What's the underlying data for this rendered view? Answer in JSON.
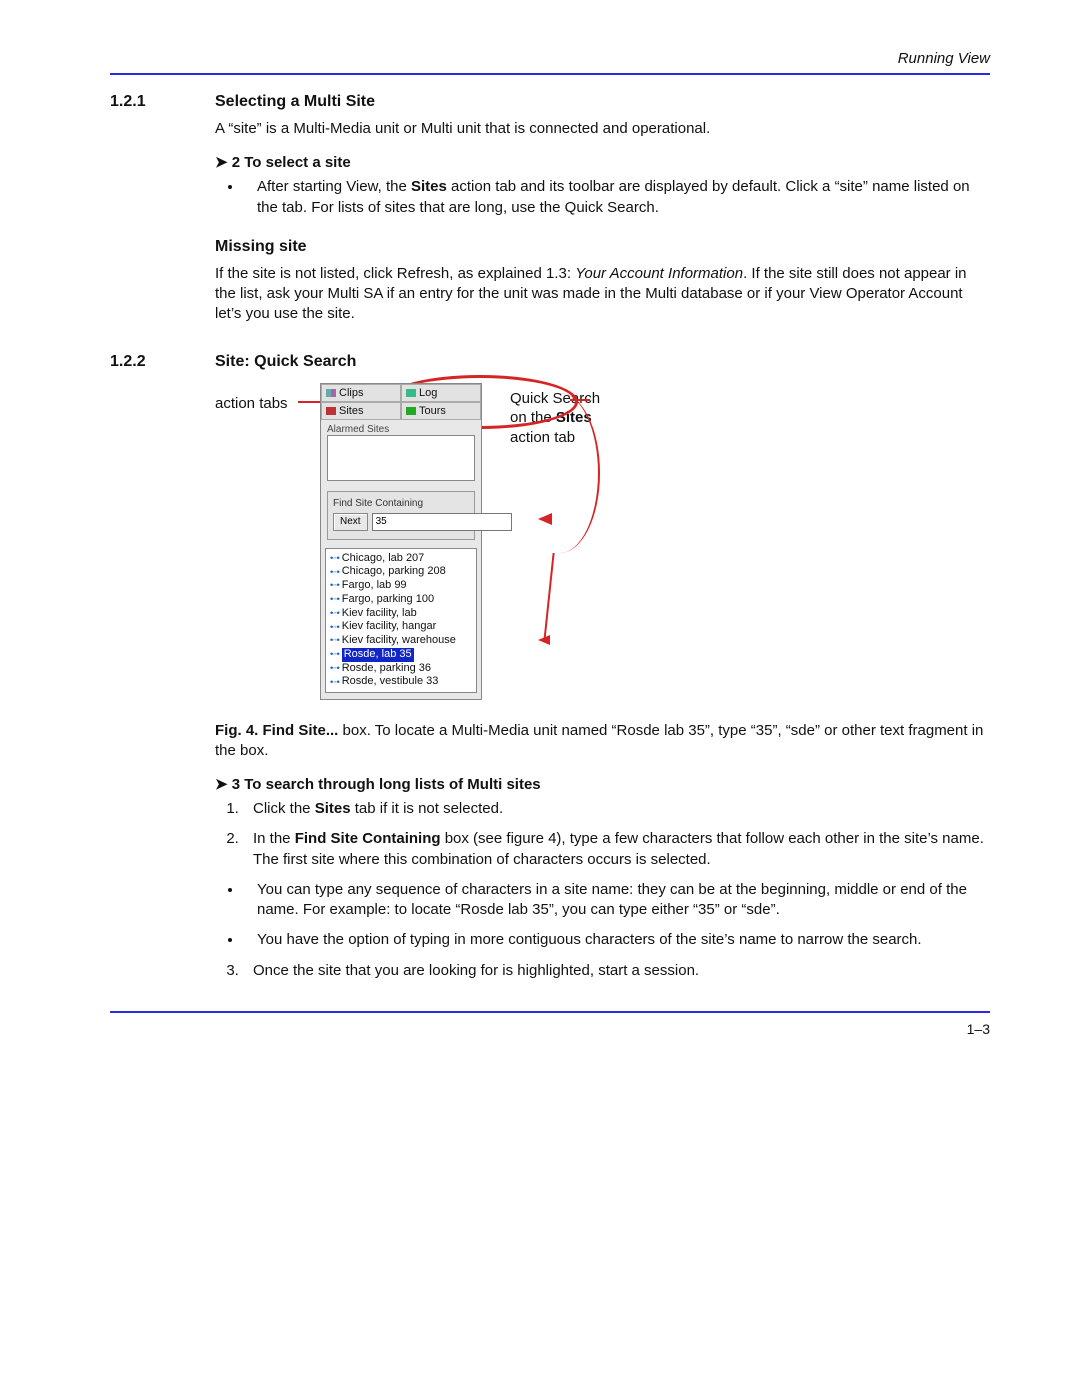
{
  "header": {
    "running": "Running View"
  },
  "sec121": {
    "num": "1.2.1",
    "title": "Selecting a Multi Site",
    "intro": "A “site” is a Multi-Media unit or Multi unit that is connected and operational.",
    "proc2_head": "➤ 2  To select a site",
    "bullet_pre": "After starting View, the ",
    "bullet_bold": "Sites",
    "bullet_post": " action tab and its toolbar are displayed by default. Click a “site” name listed on the tab. For lists of sites that are long, use the Quick Search.",
    "missing_head": "Missing site",
    "missing_pre": "If the site is not listed, click Refresh, as explained 1.3: ",
    "missing_ital": "Your Account Information",
    "missing_post": ". If the site still does not appear in the list, ask your Multi SA if an entry for the unit was made in the Multi database or if your View Operator Account let’s you use the site."
  },
  "sec122": {
    "num": "1.2.2",
    "title": "Site: Quick Search",
    "fig_left": "action tabs",
    "fig_right_l1": "Quick Search",
    "fig_right_l2_pre": "on the ",
    "fig_right_l2_bold": "Sites",
    "fig_right_l3": "action tab",
    "panel": {
      "tabs": {
        "clips": "Clips",
        "log": "Log",
        "sites": "Sites",
        "tours": "Tours"
      },
      "alarmed_title": "Alarmed Sites",
      "find_title": "Find Site Containing",
      "next_btn": "Next",
      "find_value": "35",
      "sites": [
        "Chicago, lab 207",
        "Chicago, parking 208",
        "Fargo, lab 99",
        "Fargo, parking 100",
        "Kiev facility, lab",
        "Kiev facility, hangar",
        "Kiev facility, warehouse",
        "Rosde, lab 35",
        "Rosde, parking 36",
        "Rosde, vestibule 33"
      ],
      "selected_index": 7
    },
    "caption_pre": "Fig. 4. Find Site...",
    "caption_rest": " box. To locate a Multi-Media unit named “Rosde lab 35”, type “35”, “sde” or other text fragment in the box.",
    "proc3_head": "➤ 3  To search through long lists of  Multi sites",
    "step1_pre": "Click the ",
    "step1_bold": "Sites",
    "step1_post": " tab if it is not selected.",
    "step2_pre": "In the ",
    "step2_bold": "Find Site Containing",
    "step2_post": " box (see figure 4), type a few characters that follow each other in the site’s name. The first site where this combination of characters occurs is selected.",
    "bullet2a": "You can type any sequence of characters in a site name: they can be at the beginning, middle or end of the name. For example: to locate “Rosde lab 35”, you can type either “35” or “sde”.",
    "bullet2b": "You have the option of typing in more contiguous characters of the site’s name to narrow the search.",
    "step3": " Once the site that you are looking for is highlighted, start a session."
  },
  "footer": {
    "pagenum": "1–3"
  }
}
